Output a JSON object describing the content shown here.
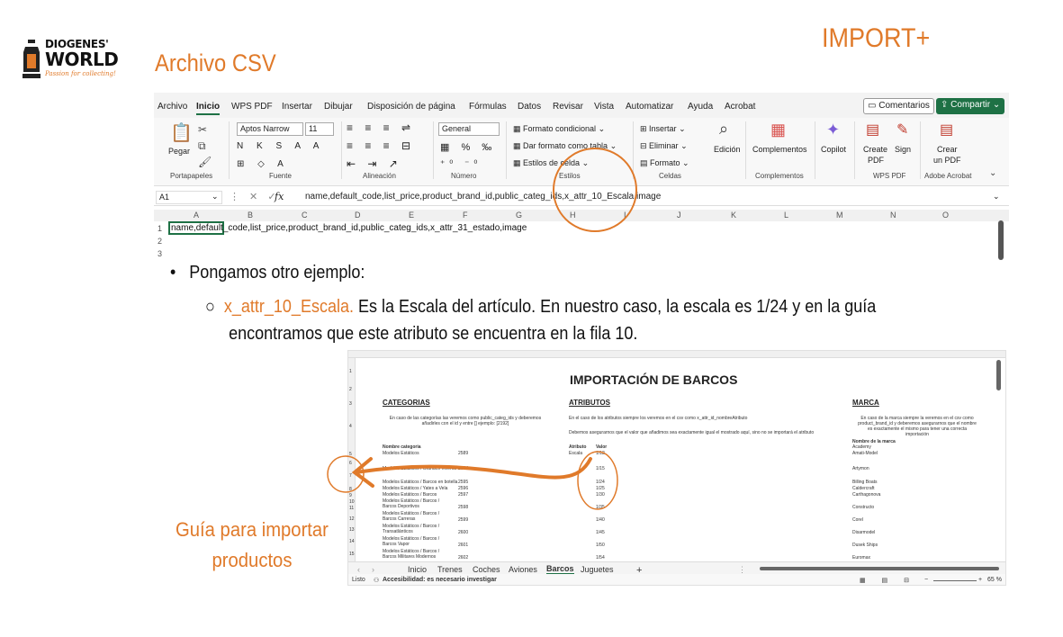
{
  "logo": {
    "line1": "DIOGENES'",
    "line2": "WORLD",
    "tagline": "Passion for collecting!"
  },
  "title": "Archivo CSV",
  "brand": "IMPORT+",
  "excel_top": {
    "menu": [
      "Archivo",
      "Inicio",
      "WPS PDF",
      "Insertar",
      "Dibujar",
      "Disposición de página",
      "Fórmulas",
      "Datos",
      "Revisar",
      "Vista",
      "Automatizar",
      "Ayuda",
      "Acrobat"
    ],
    "active_menu": "Inicio",
    "comments": "Comentarios",
    "share": "Compartir",
    "ribbon": {
      "paste": "Pegar",
      "font_name": "Aptos Narrow",
      "font_size": "11",
      "number_format": "General",
      "conditional": "Formato condicional",
      "as_table": "Dar formato como tabla",
      "cell_styles": "Estilos de celda",
      "insert": "Insertar",
      "delete": "Eliminar",
      "format": "Formato",
      "edit": "Edición",
      "complements": "Complementos",
      "copilot": "Copilot",
      "create_pdf_1": "Create",
      "create_pdf_2": "PDF",
      "sign": "Sign",
      "crear_pdf_1": "Crear",
      "crear_pdf_2": "un PDF",
      "groups": [
        "Portapapeles",
        "Fuente",
        "Alineación",
        "Número",
        "Estilos",
        "Celdas",
        "Complementos",
        "WPS PDF",
        "Adobe Acrobat"
      ]
    },
    "name_box": "A1",
    "fx": "fx",
    "formula": "name,default_code,list_price,product_brand_id,public_categ_ids,x_attr_10_Escala,image",
    "columns": [
      "A",
      "B",
      "C",
      "D",
      "E",
      "F",
      "G",
      "H",
      "I",
      "J",
      "K",
      "L",
      "M",
      "N",
      "O"
    ],
    "rows": [
      "1",
      "2",
      "3"
    ],
    "cell_a1": "name,default_code,list_price,product_brand_id,public_categ_ids,x_attr_31_estado,image"
  },
  "bullets": {
    "b1": "Pongamos otro ejemplo:",
    "b2_highlight": "x_attr_10_Escala.",
    "b2_rest": " Es la Escala del artículo. En nuestro caso, la escala es 1/24 y en la guía",
    "b2_line2": "encontramos que este atributo se encuentra en la fila 10."
  },
  "sheet2": {
    "title": "IMPORTACIÓN DE BARCOS",
    "headers": [
      "CATEGORIAS",
      "ATRIBUTOS",
      "MARCA"
    ],
    "cat_note": "En caso de las categorías las veremos como public_categ_ids y deberemos añadirles con el id y entre [] ejemplo: [2192]",
    "attr_note1": "En el caso de los atributos siempre los veremos en el csv como x_attr_id_nombreAtributo",
    "attr_note2": "Debemos asegurarnos que el valor que añadimos sea exactamente igual el mostrado aquí, sino no se importará el atributo",
    "brand_note": "En caso de la marca siempre la veremos en el csv como product_brand_id y deberemos asegurarnos que el nombre es exactamente el mismo para tener una correcta importación",
    "cat_col_header": "Nombre categoria",
    "attr_col_header": "Atributo",
    "value_col_header": "Valor",
    "brand_col_header": "Nombre de la marca",
    "row_numbers": [
      "1",
      "2",
      "3",
      "4",
      "5",
      "6",
      "7",
      "8",
      "9",
      "10",
      "11",
      "12",
      "13",
      "14",
      "15",
      "16"
    ],
    "categories": [
      {
        "name": "Modelos Estáticos",
        "id": "2589"
      },
      {
        "name": "Modelos Estáticos / Grandes Veleros",
        "id": "2594"
      },
      {
        "name": "Modelos Estáticos / Barcos en botella",
        "id": "2595"
      },
      {
        "name": "Modelos Estáticos / Yates a Vela",
        "id": "2596"
      },
      {
        "name": "Modelos Estáticos / Barcos",
        "id": "2597"
      },
      {
        "name": "Modelos Estáticos / Barcos / Barcos Deportivos",
        "id": "2598"
      },
      {
        "name": "Modelos Estáticos / Barcos / Barcos Carreras",
        "id": "2599"
      },
      {
        "name": "Modelos Estáticos / Barcos / Transatlánticos",
        "id": "2600"
      },
      {
        "name": "Modelos Estáticos / Barcos / Barcos Vapor",
        "id": "2601"
      },
      {
        "name": "Modelos Estáticos / Barcos / Barcos Militares Modernos",
        "id": "2602"
      }
    ],
    "attribute": "Escala",
    "values": [
      "1/12",
      "1/15",
      "1/24",
      "1/25",
      "1/30",
      "1/35",
      "1/40",
      "1/45",
      "1/50",
      "1/54"
    ],
    "brands": [
      "Academy",
      "Amati-Model",
      "Artymon",
      "Billing Boats",
      "Caldercraft",
      "Carthagonova",
      "Constructo",
      "Corel",
      "Disarmodel",
      "Dusek Ships",
      "Euromax"
    ],
    "tabs": [
      "Inicio",
      "Trenes",
      "Coches",
      "Aviones",
      "Barcos",
      "Juguetes"
    ],
    "active_tab": "Barcos",
    "status_ready": "Listo",
    "status_access": "Accesibilidad: es necesario investigar",
    "zoom": "65 %"
  },
  "guia": {
    "line1": "Guía para importar",
    "line2": "productos"
  },
  "colors": {
    "accent": "#e07a2a",
    "excel_green": "#1e7145"
  }
}
